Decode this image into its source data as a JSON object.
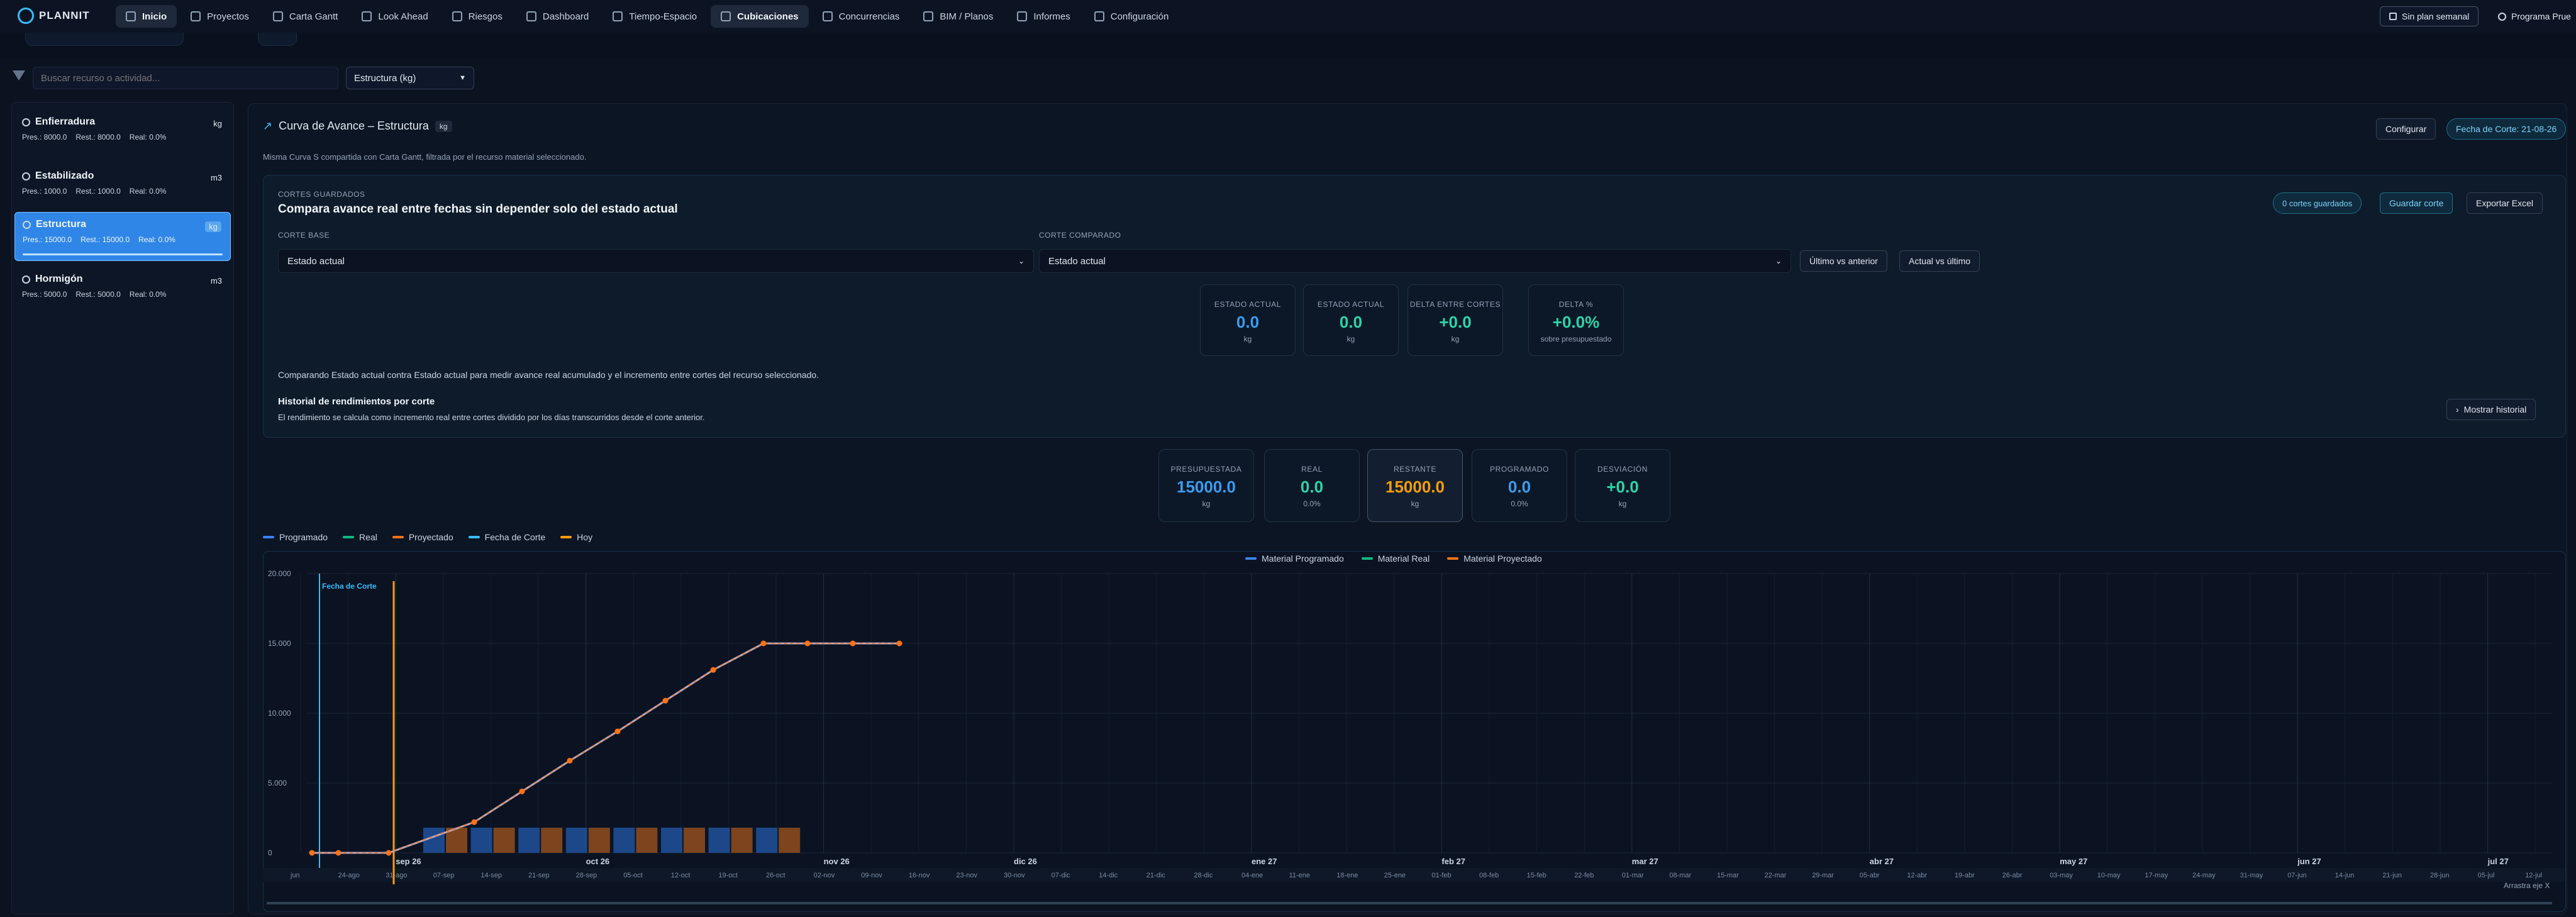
{
  "app": {
    "logo": "PLANNIT"
  },
  "nav": {
    "items": [
      {
        "label": "Inicio",
        "icon": "home-icon",
        "active": true
      },
      {
        "label": "Proyectos",
        "icon": "folder-icon"
      },
      {
        "label": "Carta Gantt",
        "icon": "gantt-icon"
      },
      {
        "label": "Look Ahead",
        "icon": "calendar-icon"
      },
      {
        "label": "Riesgos",
        "icon": "warning-icon"
      },
      {
        "label": "Dashboard",
        "icon": "dashboard-icon"
      },
      {
        "label": "Tiempo-Espacio",
        "icon": "trend-icon"
      },
      {
        "label": "Cubicaciones",
        "icon": "cube-icon",
        "active": true
      },
      {
        "label": "Concurrencias",
        "icon": "branch-icon"
      },
      {
        "label": "BIM / Planos",
        "icon": "bim-icon"
      },
      {
        "label": "Informes",
        "icon": "report-icon"
      },
      {
        "label": "Configuración",
        "icon": "gear-icon"
      }
    ],
    "plan_button": "Sin plan semanal",
    "program_label": "Programa Prue"
  },
  "filters": {
    "search_placeholder": "Buscar recurso o actividad...",
    "material_select": "Estructura (kg)"
  },
  "resources": [
    {
      "name": "Enfierradura",
      "unit": "kg",
      "stats": [
        "Pres.: 8000.0",
        "Rest.: 8000.0",
        "Real: 0.0%"
      ],
      "selected": false
    },
    {
      "name": "Estabilizado",
      "unit": "m3",
      "stats": [
        "Pres.: 1000.0",
        "Rest.: 1000.0",
        "Real: 0.0%"
      ],
      "selected": false
    },
    {
      "name": "Estructura",
      "unit": "kg",
      "stats": [
        "Pres.: 15000.0",
        "Rest.: 15000.0",
        "Real: 0.0%"
      ],
      "selected": true
    },
    {
      "name": "Hormigón",
      "unit": "m3",
      "stats": [
        "Pres.: 5000.0",
        "Rest.: 5000.0",
        "Real: 0.0%"
      ],
      "selected": false
    }
  ],
  "main": {
    "title": "Curva de Avance – Estructura",
    "unit_badge": "kg",
    "configure_button": "Configurar",
    "cut_date_button": "Fecha de Corte: 21-08-26",
    "description": "Misma Curva S compartida con Carta Gantt, filtrada por el recurso material seleccionado."
  },
  "cortes": {
    "caption": "Cortes guardados",
    "title": "Compara avance real entre fechas sin depender solo del estado actual",
    "saved_badge": "0 cortes guardados",
    "save_button": "Guardar corte",
    "export_button": "Exportar Excel",
    "base_label": "Corte base",
    "base_value": "Estado actual",
    "compare_label": "Corte comparado",
    "compare_value": "Estado actual",
    "quick1": "Último vs anterior",
    "quick2": "Actual vs último",
    "metrics": [
      {
        "label": "Estado actual",
        "value": "0.0",
        "sub": "kg",
        "color": "#3b9cf0"
      },
      {
        "label": "Estado actual",
        "value": "0.0",
        "sub": "kg",
        "color": "#2dd4a7"
      },
      {
        "label": "Delta entre cortes",
        "value": "+0.0",
        "sub": "kg",
        "color": "#2dd4a7"
      },
      {
        "label": "Delta %",
        "value": "+0.0%",
        "sub": "sobre presupuestado",
        "color": "#2dd4a7"
      }
    ],
    "comparing_text": "Comparando Estado actual contra Estado actual para medir avance real acumulado y el incremento entre cortes del recurso seleccionado.",
    "history_title": "Historial de rendimientos por corte",
    "history_desc": "El rendimiento se calcula como incremento real entre cortes dividido por los días transcurridos desde el corte anterior.",
    "history_button": "Mostrar historial"
  },
  "summary": [
    {
      "label": "Presupuestada",
      "value": "15000.0",
      "sub": "kg",
      "color": "#3b9cf0",
      "highlight": false
    },
    {
      "label": "Real",
      "value": "0.0",
      "sub": "0.0%",
      "color": "#2dd4a7",
      "highlight": false
    },
    {
      "label": "Restante",
      "value": "15000.0",
      "sub": "kg",
      "color": "#f59e0b",
      "highlight": true
    },
    {
      "label": "Programado",
      "value": "0.0",
      "sub": "0.0%",
      "color": "#3b9cf0",
      "highlight": false
    },
    {
      "label": "Desviación",
      "value": "+0.0",
      "sub": "kg",
      "color": "#2dd4a7",
      "highlight": false
    }
  ],
  "legend_top": [
    {
      "name": "Programado",
      "color": "#3b82f6"
    },
    {
      "name": "Real",
      "color": "#10b981"
    },
    {
      "name": "Proyectado",
      "color": "#f97316"
    },
    {
      "name": "Fecha de Corte",
      "color": "#38bdf8"
    },
    {
      "name": "Hoy",
      "color": "#f59e0b"
    }
  ],
  "chart_data": {
    "type": "line",
    "legend": [
      "Material Programado",
      "Material Real",
      "Material Proyectado"
    ],
    "colors": {
      "programado": "#3b82f6",
      "real": "#10b981",
      "proyectado": "#f97316",
      "corte": "#38bdf8",
      "hoy": "#f59e0b"
    },
    "y_ticks": [
      "20.000",
      "15.000",
      "10.000",
      "5.000",
      "0"
    ],
    "ylim": [
      0,
      20000
    ],
    "cut_label": "Fecha de Corte",
    "month_labels": [
      "sep 26",
      "oct 26",
      "nov 26",
      "dic 26",
      "ene 27",
      "feb 27",
      "mar 27",
      "abr 27",
      "may 27",
      "jun 27",
      "jul 27"
    ],
    "week_labels": [
      "jun",
      "24-ago",
      "31-ago",
      "07-sep",
      "14-sep",
      "21-sep",
      "28-sep",
      "05-oct",
      "12-oct",
      "19-oct",
      "26-oct",
      "02-nov",
      "09-nov",
      "16-nov",
      "23-nov",
      "30-nov",
      "07-dic",
      "14-dic",
      "21-dic",
      "28-dic",
      "04-ene",
      "11-ene",
      "18-ene",
      "25-ene",
      "01-feb",
      "08-feb",
      "15-feb",
      "22-feb",
      "01-mar",
      "08-mar",
      "15-mar",
      "22-mar",
      "29-mar",
      "05-abr",
      "12-abr",
      "19-abr",
      "26-abr",
      "03-may",
      "10-may",
      "17-may",
      "24-may",
      "31-may",
      "07-jun",
      "14-jun",
      "21-jun",
      "28-jun",
      "05-jul",
      "12-jul"
    ],
    "curve_weeks": [
      "17-ago",
      "24-ago",
      "31-ago",
      "07-sep",
      "14-sep",
      "21-sep",
      "28-sep",
      "05-oct",
      "12-oct",
      "19-oct",
      "26-oct",
      "02-nov",
      "09-nov"
    ],
    "series": [
      {
        "name": "Material Proyectado",
        "values": [
          0,
          0,
          0,
          2200,
          4400,
          6600,
          8700,
          10900,
          13100,
          15000,
          15000,
          15000,
          15000
        ]
      }
    ],
    "bars": {
      "programado": [
        0,
        0,
        1800,
        1800,
        1800,
        1800,
        1800,
        1800,
        1800,
        1800
      ],
      "proyectado": [
        0,
        0,
        1800,
        1800,
        1800,
        1800,
        1800,
        1800,
        1800,
        1800
      ]
    },
    "drag_hint": "Arrastra eje X"
  }
}
